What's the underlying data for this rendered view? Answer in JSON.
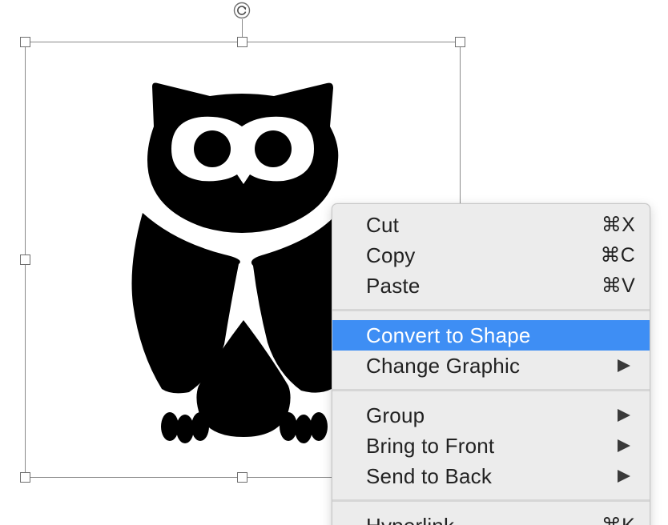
{
  "colors": {
    "menu_background": "#ececec",
    "menu_highlight": "#3e8ef4",
    "menu_text": "#222222",
    "selection_border": "#8a8a8a",
    "graphic_fill": "#000000"
  },
  "canvas": {
    "graphic": {
      "icon": "owl-icon",
      "selected": true
    },
    "rotate_handle_icon": "rotate-icon"
  },
  "context_menu": {
    "items": [
      {
        "label": "Cut",
        "shortcut": "⌘X"
      },
      {
        "label": "Copy",
        "shortcut": "⌘C"
      },
      {
        "label": "Paste",
        "shortcut": "⌘V"
      },
      {
        "label": "Convert to Shape",
        "highlighted": true
      },
      {
        "label": "Change Graphic",
        "submenu": true
      },
      {
        "label": "Group",
        "submenu": true
      },
      {
        "label": "Bring to Front",
        "submenu": true
      },
      {
        "label": "Send to Back",
        "submenu": true
      },
      {
        "label": "Hyperlink",
        "shortcut": "⌘K"
      }
    ]
  }
}
